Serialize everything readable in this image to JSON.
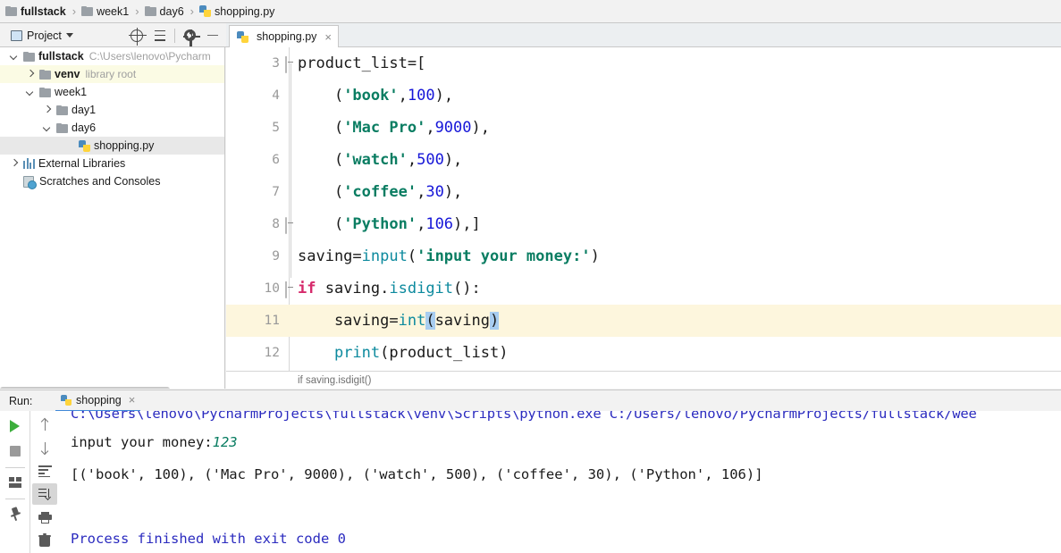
{
  "breadcrumb": {
    "items": [
      {
        "label": "fullstack",
        "icon": "folder-icon",
        "root": true
      },
      {
        "label": "week1",
        "icon": "folder-icon",
        "root": false
      },
      {
        "label": "day6",
        "icon": "folder-icon",
        "root": false
      },
      {
        "label": "shopping.py",
        "icon": "python-file-icon",
        "root": false
      }
    ],
    "separator": "›"
  },
  "toolbar": {
    "project_label": "Project",
    "icons": [
      "locate-target-icon",
      "collapse-all-icon",
      "settings-gear-icon",
      "hide-minimize-icon"
    ]
  },
  "editor_tabs": [
    {
      "label": "shopping.py",
      "close": "×",
      "active": true
    }
  ],
  "sidebar": {
    "items": [
      {
        "label": "fullstack",
        "detail": "C:\\Users\\lenovo\\Pycharm",
        "indent": 0,
        "arrow": "down",
        "icon": "folder-icon",
        "bold": true,
        "state": "none"
      },
      {
        "label": "venv",
        "detail": "library root",
        "indent": 1,
        "arrow": "right",
        "icon": "folder-icon",
        "bold": true,
        "state": "yellow"
      },
      {
        "label": "week1",
        "detail": "",
        "indent": 1,
        "arrow": "down",
        "icon": "folder-icon",
        "bold": false,
        "state": "none"
      },
      {
        "label": "day1",
        "detail": "",
        "indent": 2,
        "arrow": "right",
        "icon": "folder-icon",
        "bold": false,
        "state": "none"
      },
      {
        "label": "day6",
        "detail": "",
        "indent": 2,
        "arrow": "down",
        "icon": "folder-icon",
        "bold": false,
        "state": "none"
      },
      {
        "label": "shopping.py",
        "detail": "",
        "indent": 3,
        "arrow": "none",
        "icon": "python-file-icon",
        "bold": false,
        "state": "gray"
      },
      {
        "label": "External Libraries",
        "detail": "",
        "indent": 0,
        "arrow": "right",
        "icon": "library-icon",
        "bold": false,
        "state": "none"
      },
      {
        "label": "Scratches and Consoles",
        "detail": "",
        "indent": 0,
        "arrow": "none",
        "icon": "scratches-icon",
        "bold": false,
        "state": "none"
      }
    ]
  },
  "code": {
    "lines": [
      {
        "num": "3",
        "active": false,
        "fold": "open",
        "text": "product_list=["
      },
      {
        "num": "4",
        "active": false,
        "fold": "none",
        "text": "    ('book',100),"
      },
      {
        "num": "5",
        "active": false,
        "fold": "none",
        "text": "    ('Mac Pro',9000),"
      },
      {
        "num": "6",
        "active": false,
        "fold": "none",
        "text": "    ('watch',500),"
      },
      {
        "num": "7",
        "active": false,
        "fold": "none",
        "text": "    ('coffee',30),"
      },
      {
        "num": "8",
        "active": false,
        "fold": "close",
        "text": "    ('Python',106),]"
      },
      {
        "num": "9",
        "active": false,
        "fold": "none",
        "text": "saving=input('input your money:')"
      },
      {
        "num": "10",
        "active": false,
        "fold": "open",
        "text": "if saving.isdigit():"
      },
      {
        "num": "11",
        "active": true,
        "fold": "none",
        "text": "    saving=int(saving)"
      },
      {
        "num": "12",
        "active": false,
        "fold": "none",
        "text": "    print(product_list)"
      }
    ],
    "breadcrumb": "if saving.isdigit()"
  },
  "run_panel": {
    "label": "Run:",
    "tab_label": "shopping",
    "tab_close": "×",
    "left_rail_icons": [
      "run-play-icon",
      "stop-icon",
      "layout-settings-icon",
      "pin-tab-icon"
    ],
    "right_rail_icons": [
      "scroll-up-icon",
      "scroll-down-icon",
      "soft-wrap-icon",
      "scroll-to-end-icon",
      "print-icon",
      "clear-all-icon"
    ],
    "console": {
      "command_line": "C:\\Users\\lenovo\\PycharmProjects\\fullstack\\venv\\Scripts\\python.exe C:/Users/lenovo/PycharmProjects/fullstack/wee",
      "prompt_line": "input your money:",
      "prompt_value": "123",
      "output_line": "[('book', 100), ('Mac Pro', 9000), ('watch', 500), ('coffee', 30), ('Python', 106)]",
      "exit_line": "Process finished with exit code 0"
    }
  },
  "colors": {
    "string": "#0a7d62",
    "number": "#1616d8",
    "function": "#0d8a9e",
    "keyword": "#d62a6b",
    "active_line": "#fdf6dd",
    "bracket_match": "#a8cdf0",
    "console_path": "#2b2bbf",
    "tab_underline": "#3f88d8"
  }
}
